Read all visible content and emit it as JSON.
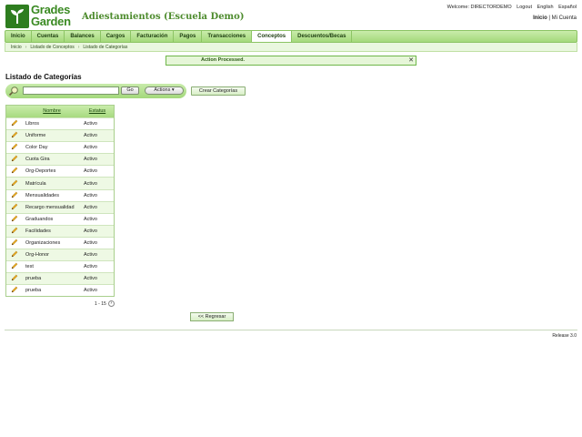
{
  "brand": {
    "logo_line1": "Grades",
    "logo_line2": "Garden",
    "school": "Adiestamientos (Escuela Demo)"
  },
  "user_links": {
    "welcome": "Welcome: DIRECTORDEMO",
    "logout": "Logout",
    "english": "English",
    "espanol": "Español",
    "inicio": "Inicio",
    "divider": "|",
    "mi_cuenta": "Mi Cuenta"
  },
  "nav": {
    "tabs": [
      "Inicio",
      "Cuentas",
      "Balances",
      "Cargos",
      "Facturación",
      "Pagos",
      "Transacciones",
      "Conceptos",
      "Descuentos/Becas"
    ],
    "active": "Conceptos"
  },
  "breadcrumb": [
    "Inicio",
    "Listado de Conceptos",
    "Listado de Categorías"
  ],
  "message": {
    "text": "Action Processed.",
    "close": "✕"
  },
  "page_title": "Listado de Categorías",
  "search": {
    "value": "",
    "go_label": "Go",
    "actions_label": "Actions"
  },
  "crear_label": "Crear Categorías",
  "table": {
    "headers": {
      "name": "Nombre",
      "status": "Estatus"
    },
    "rows": [
      {
        "name": "Libros",
        "status": "Activo"
      },
      {
        "name": "Uniforme",
        "status": "Activo"
      },
      {
        "name": "Color Day",
        "status": "Activo"
      },
      {
        "name": "Cuota Gira",
        "status": "Activo"
      },
      {
        "name": "Org-Deportes",
        "status": "Activo"
      },
      {
        "name": "Matrícula",
        "status": "Activo"
      },
      {
        "name": "Mensualidades",
        "status": "Activo"
      },
      {
        "name": "Recargo mensualidad",
        "status": "Activo"
      },
      {
        "name": "Graduandos",
        "status": "Activo"
      },
      {
        "name": "Facilidades",
        "status": "Activo"
      },
      {
        "name": "Organizaciones",
        "status": "Activo"
      },
      {
        "name": "Org-Honor",
        "status": "Activo"
      },
      {
        "name": "test",
        "status": "Activo"
      },
      {
        "name": "prueba",
        "status": "Activo"
      },
      {
        "name": "prueba",
        "status": "Activo"
      }
    ]
  },
  "pager": {
    "text": "1 - 15"
  },
  "regresar_label": "<< Regresar",
  "release": "Release 3.0",
  "colors": {
    "accent": "#4d8b2d",
    "nav_bg": "#a4d97b",
    "row_alt": "#eef9e4"
  }
}
